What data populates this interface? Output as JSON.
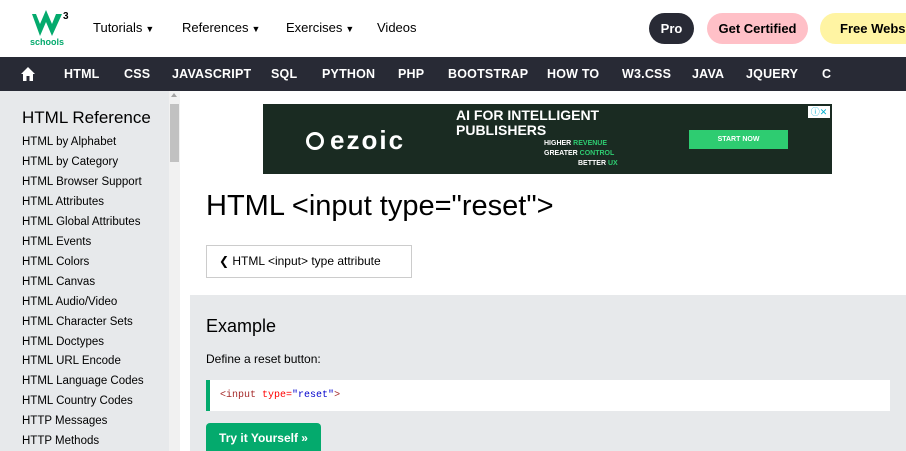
{
  "topbar": {
    "logo_text": "schools",
    "logo_sup": "3",
    "nav": [
      {
        "label": "Tutorials"
      },
      {
        "label": "References"
      },
      {
        "label": "Exercises"
      },
      {
        "label": "Videos"
      }
    ],
    "pro_label": "Pro",
    "certified_label": "Get Certified",
    "free_label": "Free Websit"
  },
  "darknav": {
    "items": [
      "HTML",
      "CSS",
      "JAVASCRIPT",
      "SQL",
      "PYTHON",
      "PHP",
      "BOOTSTRAP",
      "HOW TO",
      "W3.CSS",
      "JAVA",
      "JQUERY",
      "C"
    ]
  },
  "sidebar": {
    "title": "HTML Reference",
    "items": [
      "HTML by Alphabet",
      "HTML by Category",
      "HTML Browser Support",
      "HTML Attributes",
      "HTML Global Attributes",
      "HTML Events",
      "HTML Colors",
      "HTML Canvas",
      "HTML Audio/Video",
      "HTML Character Sets",
      "HTML Doctypes",
      "HTML URL Encode",
      "HTML Language Codes",
      "HTML Country Codes",
      "HTTP Messages",
      "HTTP Methods"
    ]
  },
  "ad": {
    "brand": "ezoic",
    "headline_1": "AI FOR INTELLIGENT",
    "headline_2": "PUBLISHERS",
    "line1_a": "HIGHER ",
    "line1_b": "REVENUE",
    "line2_a": "GREATER ",
    "line2_b": "CONTROL",
    "line3_a": "BETTER ",
    "line3_b": "UX",
    "cta": "START NOW"
  },
  "main": {
    "title": "HTML <input type=\"reset\">",
    "prev_link": "❮ HTML <input> type attribute",
    "example": {
      "title": "Example",
      "description": "Define a reset button:",
      "code_open": "<input ",
      "code_attr": "type",
      "code_eq": "=",
      "code_val": "\"reset\"",
      "code_close": ">",
      "try_label": "Try it Yourself »"
    }
  },
  "colors": {
    "accent": "#04AA6D",
    "dark_nav": "#282A35",
    "sidebar_bg": "#E7E9EB",
    "certified_bg": "#FFC0C7",
    "free_bg": "#FFF4A3"
  }
}
